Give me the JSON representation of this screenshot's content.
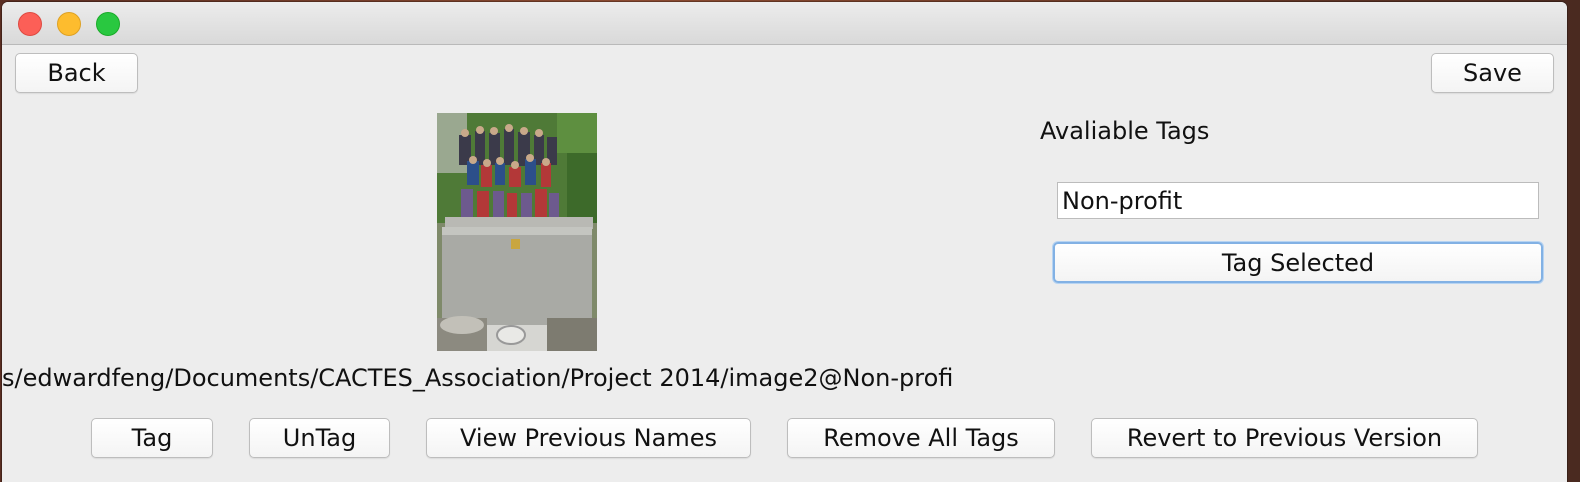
{
  "window": {
    "title": ""
  },
  "toolbar": {
    "back_label": "Back",
    "save_label": "Save"
  },
  "tags_panel": {
    "heading": "Avaliable Tags",
    "selected_tag": "Non-profit",
    "tag_selected_label": "Tag Selected"
  },
  "image": {
    "path": "s/edwardfeng/Documents/CACTES_Association/Project 2014/image2@Non-profi"
  },
  "actions": {
    "tag_label": "Tag",
    "untag_label": "UnTag",
    "view_previous_names_label": "View Previous Names",
    "remove_all_tags_label": "Remove All Tags",
    "revert_label": "Revert to Previous Version"
  },
  "colors": {
    "window_bg": "#ededed",
    "close": "#fc5f57",
    "minimize": "#fdbc2e",
    "maximize": "#29c840",
    "focus_ring": "#82b1e4"
  }
}
